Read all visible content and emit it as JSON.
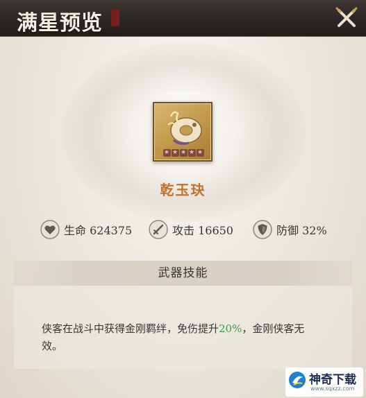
{
  "window": {
    "title": "满星预览"
  },
  "item": {
    "name": "乾玉玦",
    "stars": 5,
    "frame_color": "#c59c4e"
  },
  "stats": [
    {
      "icon": "heart-icon",
      "label": "生命 624375"
    },
    {
      "icon": "sword-icon",
      "label": "攻击 16650"
    },
    {
      "icon": "shield-icon",
      "label": "防御 32%"
    }
  ],
  "skill": {
    "header": "武器技能",
    "desc_before": "侠客在战斗中获得金刚羁绊，免伤提升",
    "desc_highlight": "20%",
    "desc_after": "，金刚侠客无效。",
    "highlight_color": "#3f9a4a"
  },
  "watermark": {
    "name": "神奇下载",
    "url": "www.sqxzz.com"
  },
  "colors": {
    "title_bar": "#2b2623",
    "item_name": "#c4722c"
  }
}
